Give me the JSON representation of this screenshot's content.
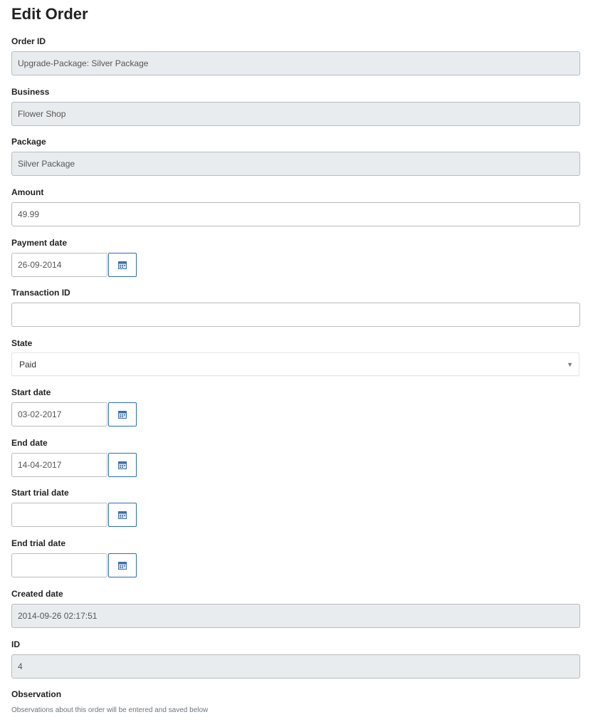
{
  "page": {
    "title": "Edit Order"
  },
  "fields": {
    "order_id": {
      "label": "Order ID",
      "value": "Upgrade-Package: Silver Package"
    },
    "business": {
      "label": "Business",
      "value": "Flower Shop"
    },
    "package": {
      "label": "Package",
      "value": "Silver Package"
    },
    "amount": {
      "label": "Amount",
      "value": "49.99"
    },
    "payment_date": {
      "label": "Payment date",
      "value": "26-09-2014"
    },
    "transaction_id": {
      "label": "Transaction ID",
      "value": ""
    },
    "state": {
      "label": "State",
      "value": "Paid"
    },
    "start_date": {
      "label": "Start date",
      "value": "03-02-2017"
    },
    "end_date": {
      "label": "End date",
      "value": "14-04-2017"
    },
    "start_trial_date": {
      "label": "Start trial date",
      "value": ""
    },
    "end_trial_date": {
      "label": "End trial date",
      "value": ""
    },
    "created_date": {
      "label": "Created date",
      "value": "2014-09-26 02:17:51"
    },
    "id": {
      "label": "ID",
      "value": "4"
    },
    "observation": {
      "label": "Observation",
      "help": "Observations about this order will be entered and saved below"
    }
  },
  "icons": {
    "calendar": "calendar-icon",
    "dropdown": "chevron-down-icon"
  },
  "colors": {
    "calendar_border": "#2c6fb3",
    "readonly_bg": "#e9ecef"
  }
}
